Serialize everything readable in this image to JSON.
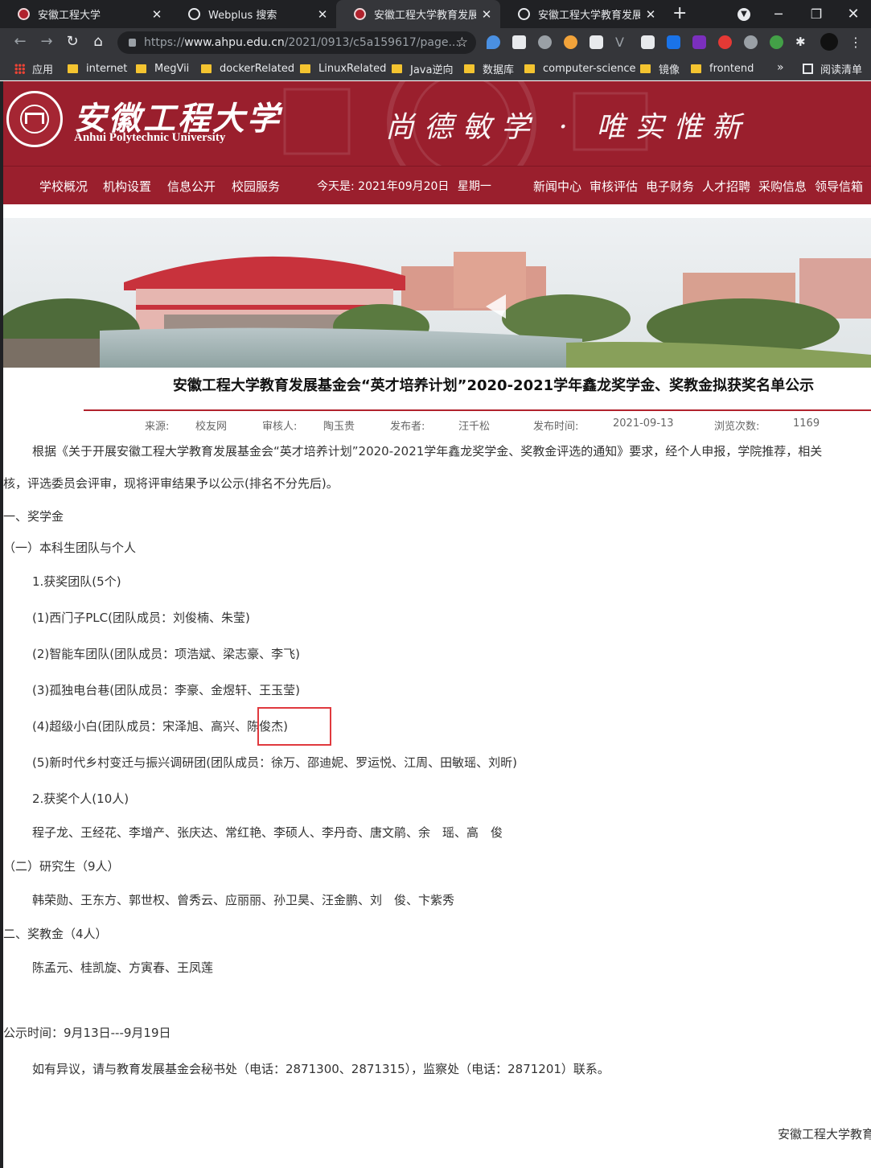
{
  "browser": {
    "tabs": [
      {
        "title": "安徽工程大学",
        "favicon": "university-favicon",
        "active": false
      },
      {
        "title": "Webplus 搜索",
        "favicon": "globe-icon",
        "active": false
      },
      {
        "title": "安徽工程大学教育发展基金",
        "favicon": "university-favicon",
        "active": true
      },
      {
        "title": "安徽工程大学教育发展基金",
        "favicon": "globe-icon",
        "active": false
      }
    ],
    "address": {
      "prefix": "https://",
      "host": "www.ahpu.edu.cn",
      "path": "/2021/0913/c5a159617/page..."
    },
    "bookmarks": [
      {
        "label": "应用",
        "kind": "apps"
      },
      {
        "label": "internet",
        "kind": "folder"
      },
      {
        "label": "MegVii",
        "kind": "folder"
      },
      {
        "label": "dockerRelated",
        "kind": "folder"
      },
      {
        "label": "LinuxRelated",
        "kind": "folder"
      },
      {
        "label": "Java逆向",
        "kind": "folder"
      },
      {
        "label": "数据库",
        "kind": "folder"
      },
      {
        "label": "computer-science",
        "kind": "folder"
      },
      {
        "label": "镜像",
        "kind": "folder"
      },
      {
        "label": "frontend",
        "kind": "folder"
      }
    ],
    "bookmarks_more": "»",
    "reading_list": "阅读清单"
  },
  "header": {
    "logo_cn": "安徽工程大学",
    "logo_en": "Anhui Polytechnic University",
    "motto": "尚德敏学 · 唯实惟新"
  },
  "nav": {
    "left": [
      "学校概况",
      "机构设置",
      "信息公开",
      "校园服务"
    ],
    "date_label": "今天是:",
    "date_value": "2021年09月20日",
    "weekday": "星期一",
    "right": [
      "新闻中心",
      "审核评估",
      "电子财务",
      "人才招聘",
      "采购信息",
      "领导信箱"
    ]
  },
  "article": {
    "title": "安徽工程大学教育发展基金会“英才培养计划”2020-2021学年鑫龙奖学金、奖教金拟获奖名单公示",
    "meta": {
      "source_label": "来源:",
      "source": "校友网",
      "reviewer_label": "审核人:",
      "reviewer": "陶玉贵",
      "publisher_label": "发布者:",
      "publisher": "汪千松",
      "date_label": "发布时间:",
      "date": "2021-09-13",
      "views_label": "浏览次数:",
      "views": "1169"
    },
    "intro_1": "根据《关于开展安徽工程大学教育发展基金会“英才培养计划”2020-2021学年鑫龙奖学金、奖教金评选的通知》要求，经个人申报，学院推荐，相关",
    "intro_2": "核，评选委员会评审，现将评审结果予以公示(排名不分先后)。",
    "sec1": "一、奖学金",
    "sec1_1": "（一）本科生团队与个人",
    "teams_heading": "1.获奖团队(5个)",
    "team_1": "(1)西门子PLC(团队成员：刘俊楠、朱莹)",
    "team_2": "(2)智能车团队(团队成员：项浩斌、梁志豪、李飞)",
    "team_3": "(3)孤独电台巷(团队成员：李豪、金煜轩、王玉莹)",
    "team_4": "(4)超级小白(团队成员：宋泽旭、高兴、陈俊杰)",
    "team_5": "(5)新时代乡村变迁与振兴调研团(团队成员：徐万、邵迪妮、罗运悦、江周、田敏瑶、刘昕)",
    "indiv_heading": "2.获奖个人(10人)",
    "indiv_names": "程子龙、王经花、李增产、张庆达、常红艳、李硕人、李丹奇、唐文鹃、余　瑶、高　俊",
    "sec1_2": "（二）研究生（9人）",
    "grad_names": "韩荣勋、王东方、郭世权、曾秀云、应丽丽、孙卫昊、汪金鹏、刘　俊、卞紫秀",
    "sec2": "二、奖教金（4人）",
    "teacher_names": "陈孟元、桂凯旋、方寅春、王凤莲",
    "period": "公示时间：9月13日---9月19日",
    "contact": "如有异议，请与教育发展基金会秘书处（电话：2871300、2871315），监察处（电话：2871201）联系。",
    "signature": "安徽工程大学教育"
  },
  "colors": {
    "brand": "#9a1f2d",
    "title_rule": "#b1222d",
    "highlight": "#e0393e",
    "chrome_dark": "#202124",
    "chrome_bar": "#35363a"
  }
}
